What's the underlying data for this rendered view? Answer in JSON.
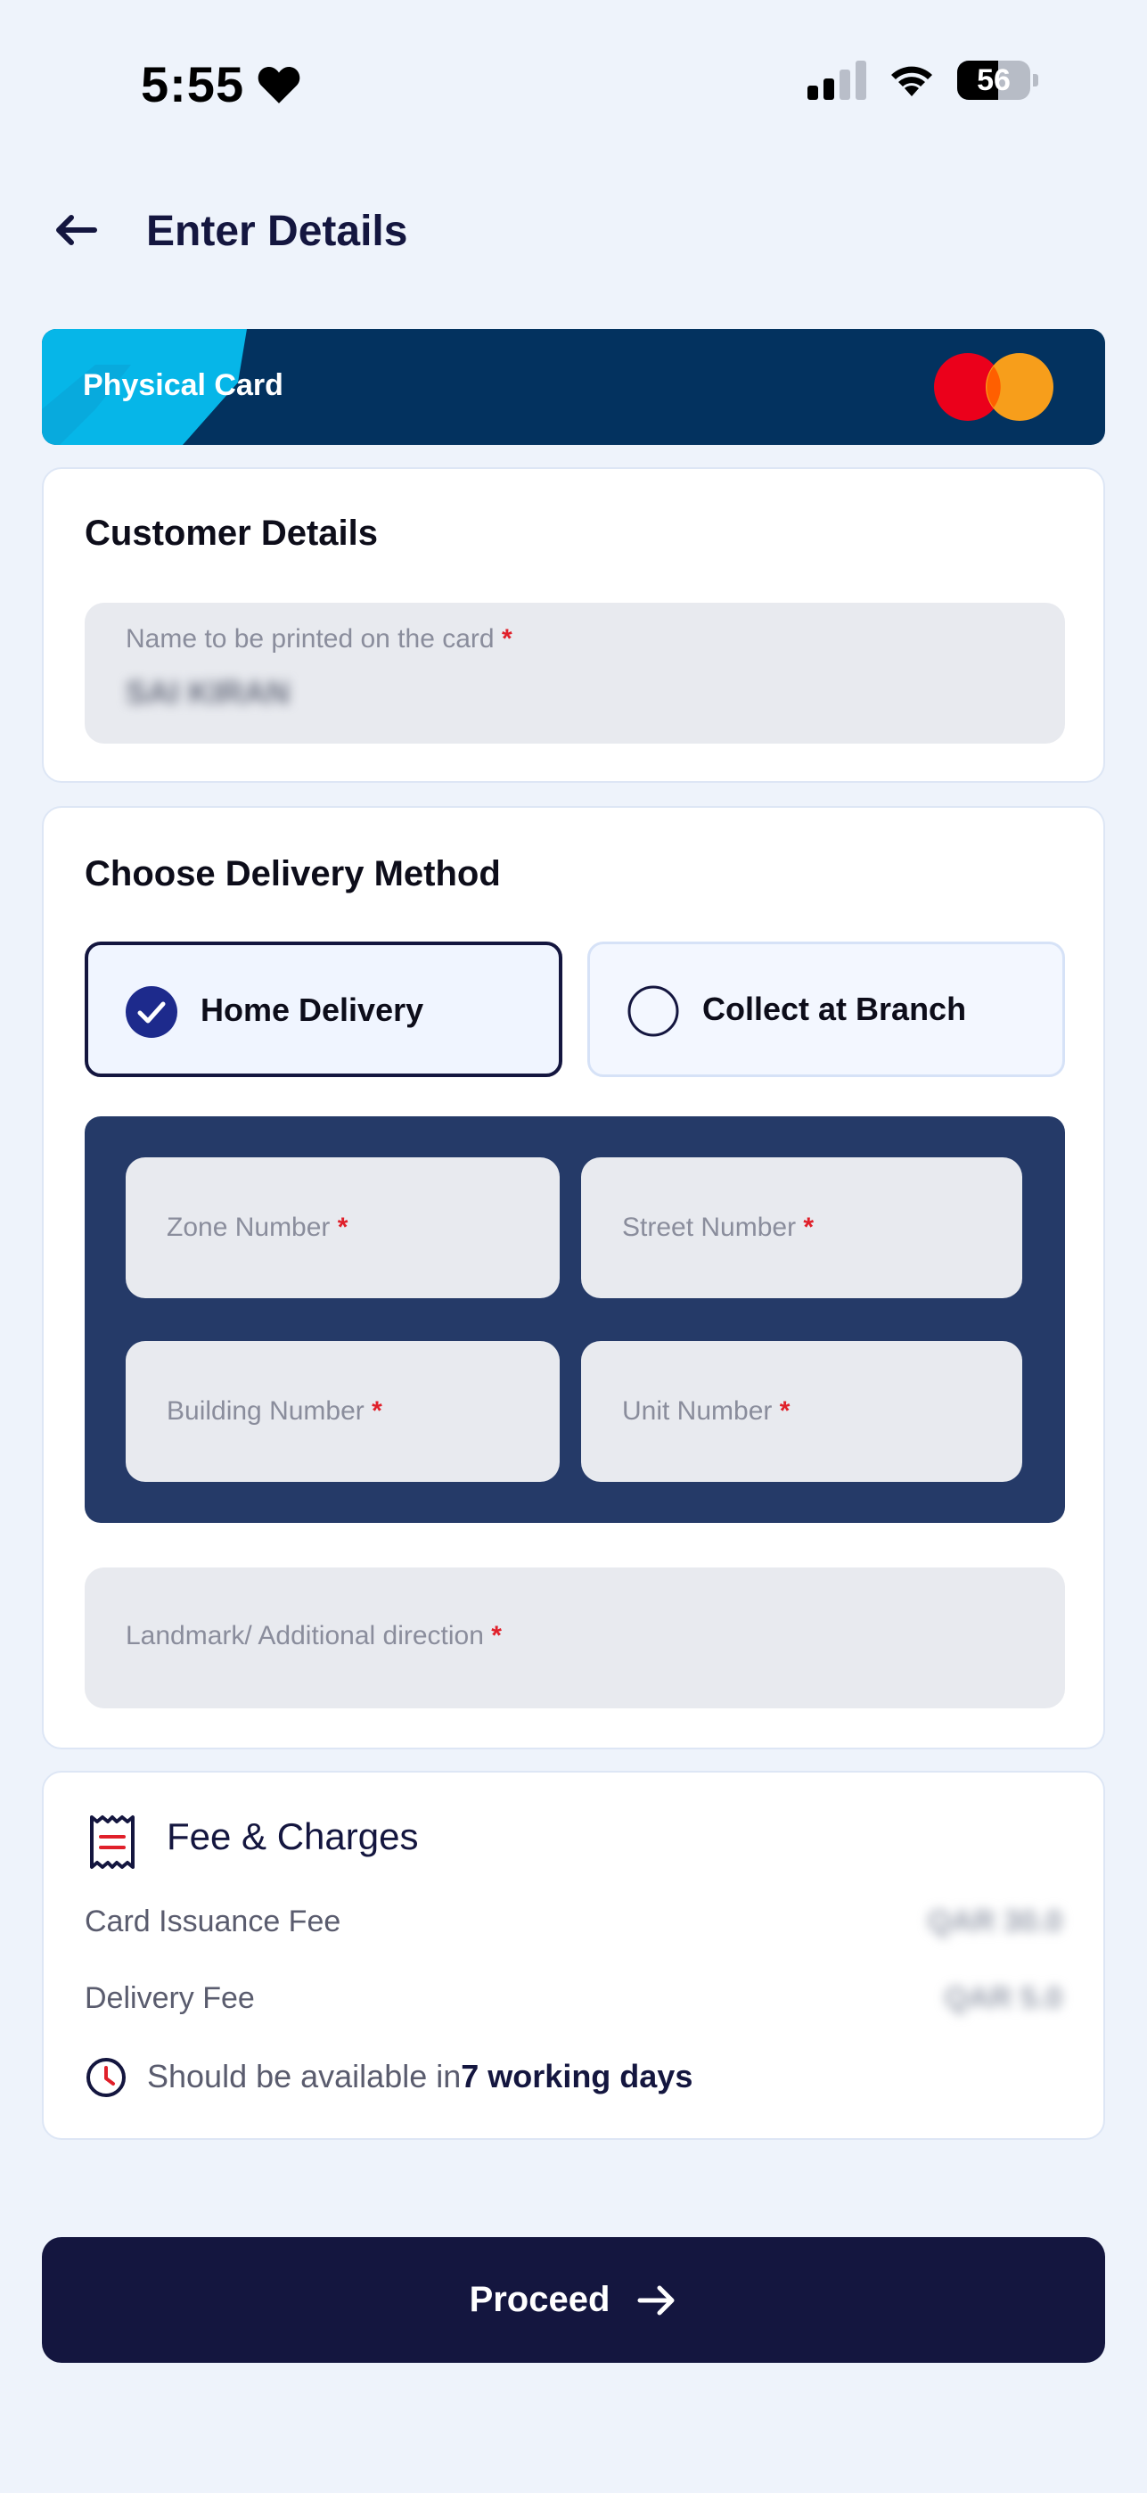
{
  "status_bar": {
    "time": "5:55",
    "battery": "56"
  },
  "header": {
    "title": "Enter Details"
  },
  "card": {
    "label": "Physical Card",
    "brand_icon": "mastercard-logo"
  },
  "customer_details": {
    "title": "Customer Details",
    "name_field": {
      "label": "Name to be printed on the card",
      "required_mark": "*",
      "value": "SAI KIRAN"
    }
  },
  "delivery": {
    "title": "Choose Delivery Method",
    "options": [
      {
        "label": "Home Delivery",
        "selected": true
      },
      {
        "label": "Collect at Branch",
        "selected": false
      }
    ],
    "address_fields": {
      "zone": "Zone Number",
      "street": "Street Number",
      "building": "Building Number",
      "unit": "Unit Number"
    },
    "landmark": "Landmark/ Additional direction",
    "required_mark": "*"
  },
  "fees": {
    "title": "Fee & Charges",
    "rows": [
      {
        "label": "Card Issuance Fee",
        "value": "QAR 30.0"
      },
      {
        "label": "Delivery Fee",
        "value": "QAR 5.0"
      }
    ],
    "availability_prefix": "Should be available in",
    "availability_value": "7 working days"
  },
  "footer": {
    "proceed_label": "Proceed"
  },
  "colors": {
    "primary": "#14163f",
    "card_bg": "#03325f",
    "card_accent": "#06b6e8",
    "address_block": "#253a68",
    "required": "#e0202a",
    "background": "#eef3fb"
  }
}
